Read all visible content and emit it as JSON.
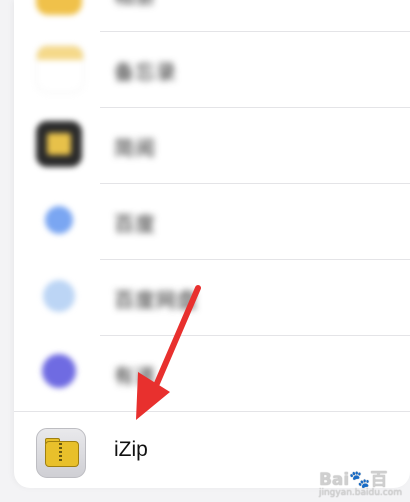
{
  "apps": [
    {
      "label": "相册",
      "icon": "photos-icon"
    },
    {
      "label": "备忘录",
      "icon": "notes-icon"
    },
    {
      "label": "简阅",
      "icon": "reader-icon"
    },
    {
      "label": "百度",
      "icon": "baidu-icon"
    },
    {
      "label": "百度网盘",
      "icon": "baidu-netdisk-icon"
    },
    {
      "label": "有道",
      "icon": "youdao-icon"
    },
    {
      "label": "iZip",
      "icon": "izip-folder-icon"
    }
  ],
  "annotation": {
    "arrow_color": "#e8302e",
    "points_to": "iZip"
  },
  "watermark": {
    "brand": "Bai",
    "paw": "🐾",
    "brand_end": "百",
    "sub": "jingyan.baidu.com"
  }
}
